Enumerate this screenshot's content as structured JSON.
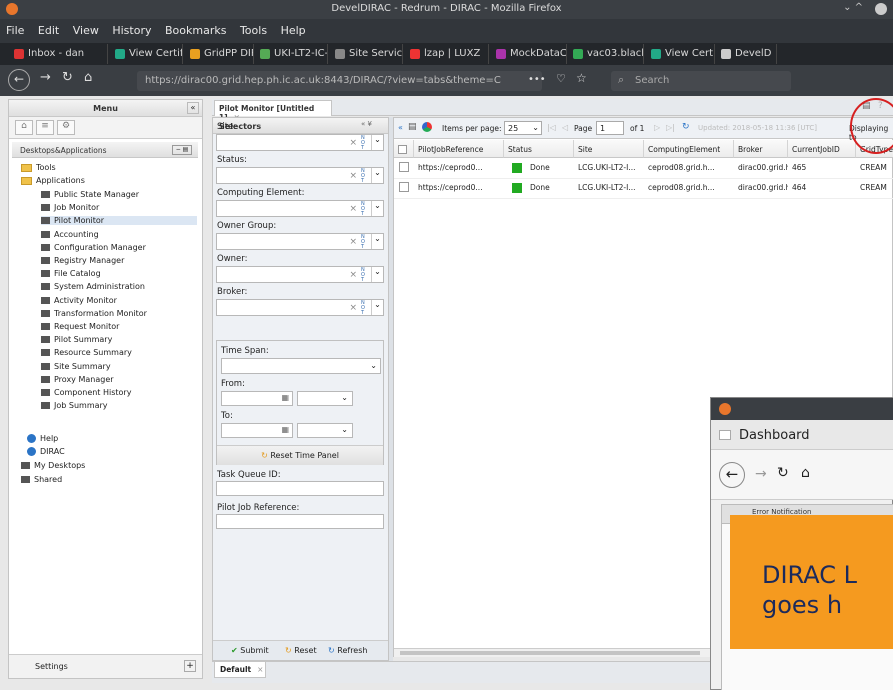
{
  "window": {
    "title": "DevelDIRAC - Redrum - DIRAC - Mozilla Firefox"
  },
  "menu": [
    "File",
    "Edit",
    "View",
    "History",
    "Bookmarks",
    "Tools",
    "Help"
  ],
  "browser_tabs": [
    {
      "label": "Inbox - dan",
      "color": "#d33"
    },
    {
      "label": "View Certifi",
      "color": "#2a8"
    },
    {
      "label": "GridPP DIRA",
      "color": "#e9a020"
    },
    {
      "label": "UKI-LT2-IC-I",
      "color": "#5a5"
    },
    {
      "label": "Site Service",
      "color": "#888"
    },
    {
      "label": "lzap | LUXZ",
      "color": "#e33"
    },
    {
      "label": "MockDataC",
      "color": "#a3a"
    },
    {
      "label": "vac03.black",
      "color": "#3a5"
    },
    {
      "label": "View Certifi",
      "color": "#2a8"
    },
    {
      "label": "DevelD",
      "color": "#ccc"
    }
  ],
  "url": "https://dirac00.grid.hep.ph.ic.ac.uk:8443/DIRAC/?view=tabs&theme=C",
  "search_placeholder": "Search",
  "left": {
    "menu_title": "Menu",
    "tree_title": "Desktops&Applications",
    "tools": "Tools",
    "applications": "Applications",
    "apps": [
      "Public State Manager",
      "Job Monitor",
      "Pilot Monitor",
      "Accounting",
      "Configuration Manager",
      "Registry Manager",
      "File Catalog",
      "System Administration",
      "Activity Monitor",
      "Transformation Monitor",
      "Request Monitor",
      "Pilot Summary",
      "Resource Summary",
      "Site Summary",
      "Proxy Manager",
      "Component History",
      "Job Summary"
    ],
    "help": "Help",
    "dirac": "DIRAC",
    "my_desktops": "My Desktops",
    "shared": "Shared",
    "settings": "Settings"
  },
  "main_tab": "Pilot Monitor [Untitled 1]",
  "selectors": {
    "title": "Selectors",
    "fields": [
      "Site:",
      "Status:",
      "Computing Element:",
      "Owner Group:",
      "Owner:",
      "Broker:"
    ],
    "time_span": "Time Span:",
    "from": "From:",
    "to": "To:",
    "reset_time": "Reset Time Panel",
    "task_queue": "Task Queue ID:",
    "pilot_ref": "Pilot Job Reference:",
    "submit": "Submit",
    "reset": "Reset",
    "refresh": "Refresh"
  },
  "toolbar": {
    "items_per_page": "Items per page:",
    "per_page_value": "25",
    "page_label": "Page",
    "page_value": "1",
    "of_pages": "of 1",
    "updated": "Updated: 2018-05-18 11:36 [UTC]",
    "displaying": "Displaying to"
  },
  "grid": {
    "headers": [
      "PilotJobReference",
      "Status",
      "Site",
      "ComputingElement",
      "Broker",
      "CurrentJobID",
      "GridType"
    ],
    "rows": [
      [
        "https://ceprod0...",
        "Done",
        "LCG.UKI-LT2-I...",
        "ceprod08.grid.h...",
        "dirac00.grid.he...",
        "465",
        "CREAM"
      ],
      [
        "https://ceprod0...",
        "Done",
        "LCG.UKI-LT2-I...",
        "ceprod08.grid.h...",
        "dirac00.grid.he...",
        "464",
        "CREAM"
      ]
    ],
    "status_color": "#22aa22"
  },
  "bottom_tab": "Default",
  "popup": {
    "tab": "Dashboard",
    "notification": "Error Notification",
    "banner": "DIRAC L\ngoes h"
  },
  "colors": {
    "accent": "#f59a1f",
    "highlight_circle": "#d62020"
  }
}
